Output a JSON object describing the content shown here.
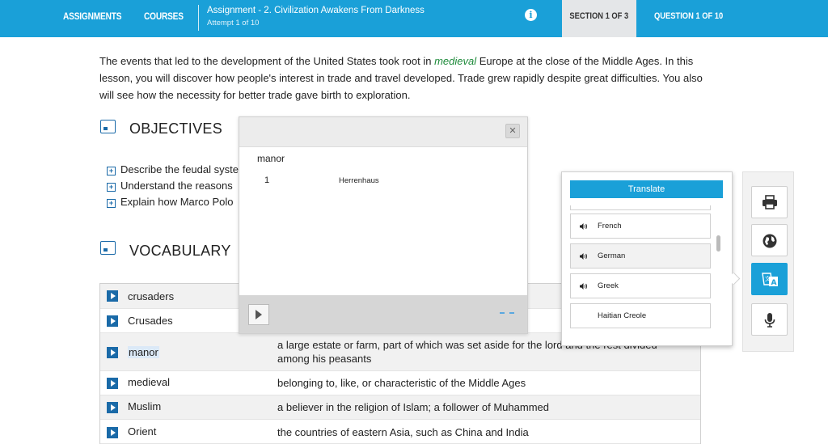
{
  "topbar": {
    "assignments": "ASSIGNMENTS",
    "courses": "COURSES",
    "assignment_title": "Assignment  - 2. Civilization Awakens From Darkness",
    "attempt": "Attempt 1 of 10",
    "info_icon": "info-icon",
    "section": "SECTION 1 OF 3",
    "question": "QUESTION 1 OF 10"
  },
  "intro": {
    "before": "The events that led to the development of the United States took root in ",
    "link": "medieval",
    "after": " Europe at the close of the Middle Ages. In this lesson, you will discover how people's interest in trade and travel developed. Trade grew rapidly despite great difficulties. You also will see how the necessity for better trade gave birth to exploration."
  },
  "objectives": {
    "title": "OBJECTIVES",
    "items": [
      "Describe the feudal system",
      "Understand the reasons",
      "Explain how Marco Polo"
    ]
  },
  "vocabulary": {
    "title": "VOCABULARY",
    "rows": [
      {
        "term": "crusaders",
        "definition": ""
      },
      {
        "term": "Crusades",
        "definition": ""
      },
      {
        "term": "manor",
        "definition": "a large estate or farm, part of which was set aside for the lord and the rest divided among his peasants"
      },
      {
        "term": "medieval",
        "definition": "belonging to, like, or characteristic of the Middle Ages"
      },
      {
        "term": "Muslim",
        "definition": "a believer in the religion of Islam; a follower of Muhammed"
      },
      {
        "term": "Orient",
        "definition": "the countries of eastern Asia, such as China and India"
      }
    ]
  },
  "dictionary": {
    "word": "manor",
    "number": "1",
    "translation": "Herrenhaus",
    "close_icon": "close-icon",
    "play_icon": "play-icon"
  },
  "translate": {
    "button": "Translate",
    "languages": [
      "French",
      "German",
      "Greek",
      "Haitian Creole"
    ],
    "selected": "German"
  },
  "tools": [
    "print-icon",
    "globe-icon",
    "translate-icon",
    "microphone-icon"
  ],
  "colors": {
    "brand": "#1aa0d8",
    "icon_blue": "#1a6aa8",
    "vocab_link": "#1d8a3a"
  }
}
